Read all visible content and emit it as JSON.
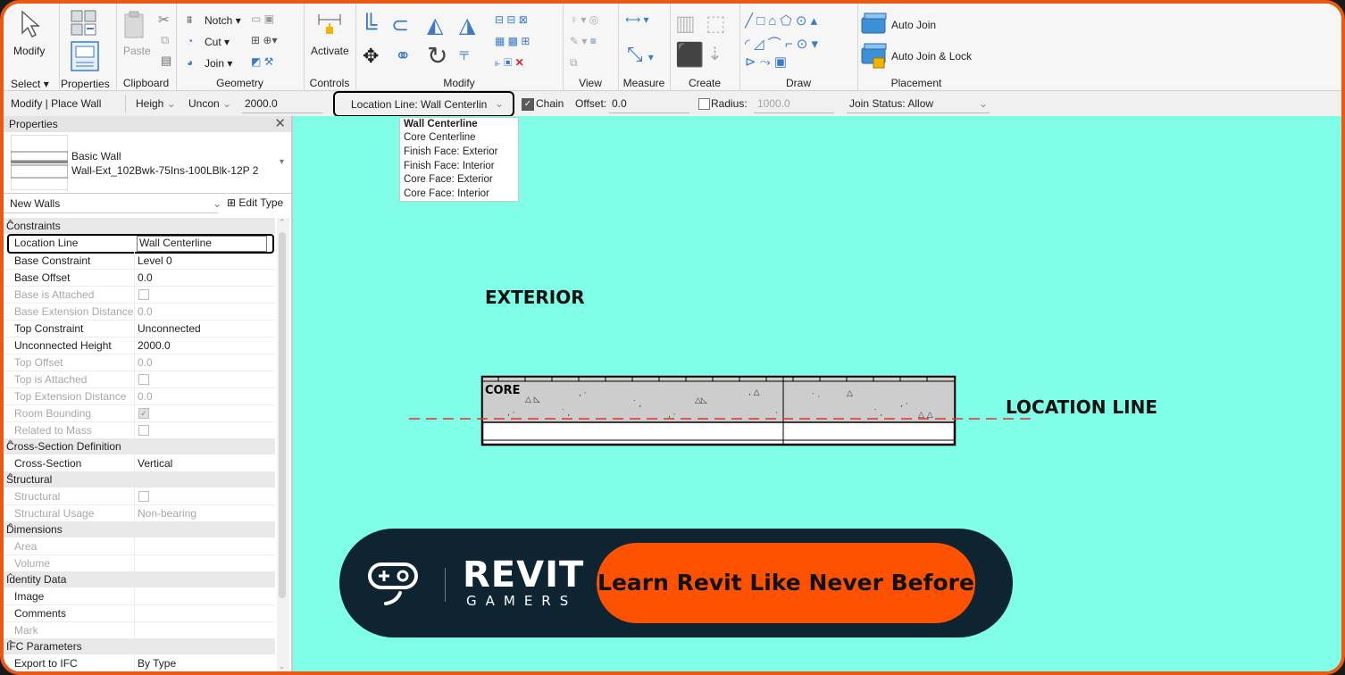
{
  "ribbon": {
    "modify": {
      "label": "Modify"
    },
    "select": {
      "label": "Select"
    },
    "properties": {
      "label": "Properties"
    },
    "clipboard": {
      "paste": "Paste",
      "panel": "Clipboard"
    },
    "geometry": {
      "notch": "Notch",
      "cut": "Cut",
      "join": "Join",
      "panel": "Geometry"
    },
    "controls": {
      "activate": "Activate",
      "panel": "Controls"
    },
    "modify_panel": {
      "panel": "Modify"
    },
    "view_panel": {
      "panel": "View"
    },
    "measure_panel": {
      "panel": "Measure"
    },
    "create_panel": {
      "panel": "Create"
    },
    "draw_panel": {
      "panel": "Draw"
    },
    "placement": {
      "auto_join": "Auto Join",
      "auto_join_lock": "Auto Join & Lock",
      "panel": "Placement"
    }
  },
  "options_bar": {
    "context": "Modify | Place Wall",
    "height_mode": "Heigh",
    "height_target": "Uncon",
    "height_value": "2000.0",
    "location_line": "Location Line: Wall Centerlin",
    "chain_label": "Chain",
    "chain_checked": true,
    "offset_label": "Offset:",
    "offset_value": "0.0",
    "radius_label": "Radius:",
    "radius_value": "1000.0",
    "join_status": "Join Status: Allow"
  },
  "location_dropdown": {
    "options": [
      "Wall Centerline",
      "Core Centerline",
      "Finish Face: Exterior",
      "Finish Face: Interior",
      "Core Face: Exterior",
      "Core Face: Interior"
    ],
    "selected": "Wall Centerline"
  },
  "properties": {
    "title": "Properties",
    "type_family": "Basic Wall",
    "type_name": "Wall-Ext_102Bwk-75Ins-100LBlk-12P 2",
    "instance_filter": "New Walls",
    "edit_type": "Edit Type",
    "groups": [
      {
        "name": "Constraints",
        "rows": [
          {
            "name": "Location Line",
            "value": "Wall Centerline"
          },
          {
            "name": "Base Constraint",
            "value": "Level 0"
          },
          {
            "name": "Base Offset",
            "value": "0.0"
          },
          {
            "name": "Base is Attached",
            "value": ""
          },
          {
            "name": "Base Extension Distance",
            "value": "0.0"
          },
          {
            "name": "Top Constraint",
            "value": "Unconnected"
          },
          {
            "name": "Unconnected Height",
            "value": "2000.0"
          },
          {
            "name": "Top Offset",
            "value": "0.0"
          },
          {
            "name": "Top is Attached",
            "value": ""
          },
          {
            "name": "Top Extension Distance",
            "value": "0.0"
          },
          {
            "name": "Room Bounding",
            "value": ""
          },
          {
            "name": "Related to Mass",
            "value": ""
          }
        ]
      },
      {
        "name": "Cross-Section Definition",
        "rows": [
          {
            "name": "Cross-Section",
            "value": "Vertical"
          }
        ]
      },
      {
        "name": "Structural",
        "rows": [
          {
            "name": "Structural",
            "value": ""
          },
          {
            "name": "Structural Usage",
            "value": "Non-bearing"
          }
        ]
      },
      {
        "name": "Dimensions",
        "rows": [
          {
            "name": "Area",
            "value": ""
          },
          {
            "name": "Volume",
            "value": ""
          }
        ]
      },
      {
        "name": "Identity Data",
        "rows": [
          {
            "name": "Image",
            "value": ""
          },
          {
            "name": "Comments",
            "value": ""
          },
          {
            "name": "Mark",
            "value": ""
          }
        ]
      },
      {
        "name": "IFC Parameters",
        "rows": [
          {
            "name": "Export to IFC",
            "value": "By Type"
          }
        ]
      }
    ]
  },
  "canvas": {
    "exterior_label": "EXTERIOR",
    "core_label": "CORE",
    "location_line_label": "LOCATION LINE",
    "background": "#7ffde7",
    "location_line_color": "#e0352b"
  },
  "banner": {
    "brand_top": "REVIT",
    "brand_bottom": "GAMERS",
    "cta": "Learn Revit Like Never Before",
    "bg_color": "#0e2430",
    "cta_color": "#fe5200",
    "frame_color": "#ea5a13"
  }
}
